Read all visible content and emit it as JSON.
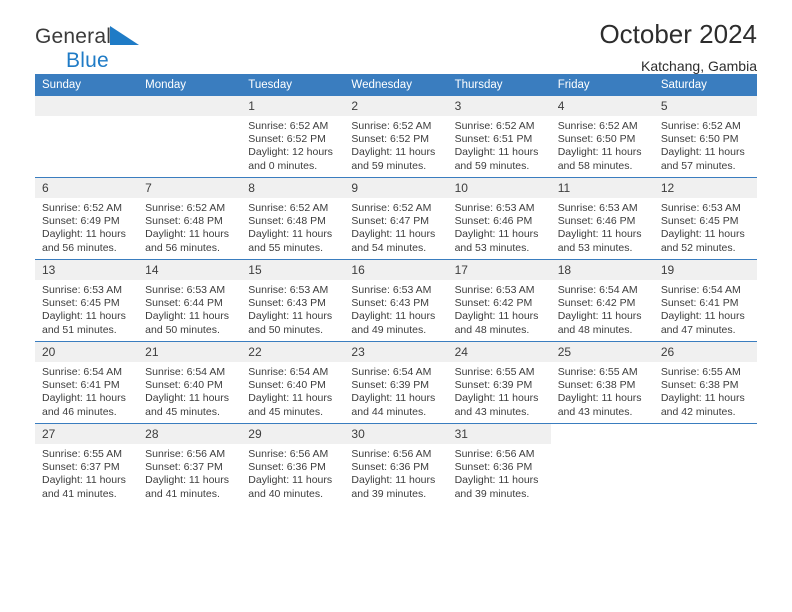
{
  "brand": {
    "name_top": "General",
    "name_bottom": "Blue",
    "flag_icon": "blue-triangle-flag-icon",
    "accent_color": "#1f7bc6"
  },
  "header": {
    "title": "October 2024",
    "subtitle": "Katchang, Gambia"
  },
  "calendar": {
    "header_bg": "#3a7dbf",
    "daynum_bg": "#f0f0f0",
    "weekday_headers": [
      "Sunday",
      "Monday",
      "Tuesday",
      "Wednesday",
      "Thursday",
      "Friday",
      "Saturday"
    ],
    "weeks": [
      [
        {
          "day": "",
          "info": ""
        },
        {
          "day": "",
          "info": ""
        },
        {
          "day": "1",
          "info": "Sunrise: 6:52 AM\nSunset: 6:52 PM\nDaylight: 12 hours\nand 0 minutes."
        },
        {
          "day": "2",
          "info": "Sunrise: 6:52 AM\nSunset: 6:52 PM\nDaylight: 11 hours\nand 59 minutes."
        },
        {
          "day": "3",
          "info": "Sunrise: 6:52 AM\nSunset: 6:51 PM\nDaylight: 11 hours\nand 59 minutes."
        },
        {
          "day": "4",
          "info": "Sunrise: 6:52 AM\nSunset: 6:50 PM\nDaylight: 11 hours\nand 58 minutes."
        },
        {
          "day": "5",
          "info": "Sunrise: 6:52 AM\nSunset: 6:50 PM\nDaylight: 11 hours\nand 57 minutes."
        }
      ],
      [
        {
          "day": "6",
          "info": "Sunrise: 6:52 AM\nSunset: 6:49 PM\nDaylight: 11 hours\nand 56 minutes."
        },
        {
          "day": "7",
          "info": "Sunrise: 6:52 AM\nSunset: 6:48 PM\nDaylight: 11 hours\nand 56 minutes."
        },
        {
          "day": "8",
          "info": "Sunrise: 6:52 AM\nSunset: 6:48 PM\nDaylight: 11 hours\nand 55 minutes."
        },
        {
          "day": "9",
          "info": "Sunrise: 6:52 AM\nSunset: 6:47 PM\nDaylight: 11 hours\nand 54 minutes."
        },
        {
          "day": "10",
          "info": "Sunrise: 6:53 AM\nSunset: 6:46 PM\nDaylight: 11 hours\nand 53 minutes."
        },
        {
          "day": "11",
          "info": "Sunrise: 6:53 AM\nSunset: 6:46 PM\nDaylight: 11 hours\nand 53 minutes."
        },
        {
          "day": "12",
          "info": "Sunrise: 6:53 AM\nSunset: 6:45 PM\nDaylight: 11 hours\nand 52 minutes."
        }
      ],
      [
        {
          "day": "13",
          "info": "Sunrise: 6:53 AM\nSunset: 6:45 PM\nDaylight: 11 hours\nand 51 minutes."
        },
        {
          "day": "14",
          "info": "Sunrise: 6:53 AM\nSunset: 6:44 PM\nDaylight: 11 hours\nand 50 minutes."
        },
        {
          "day": "15",
          "info": "Sunrise: 6:53 AM\nSunset: 6:43 PM\nDaylight: 11 hours\nand 50 minutes."
        },
        {
          "day": "16",
          "info": "Sunrise: 6:53 AM\nSunset: 6:43 PM\nDaylight: 11 hours\nand 49 minutes."
        },
        {
          "day": "17",
          "info": "Sunrise: 6:53 AM\nSunset: 6:42 PM\nDaylight: 11 hours\nand 48 minutes."
        },
        {
          "day": "18",
          "info": "Sunrise: 6:54 AM\nSunset: 6:42 PM\nDaylight: 11 hours\nand 48 minutes."
        },
        {
          "day": "19",
          "info": "Sunrise: 6:54 AM\nSunset: 6:41 PM\nDaylight: 11 hours\nand 47 minutes."
        }
      ],
      [
        {
          "day": "20",
          "info": "Sunrise: 6:54 AM\nSunset: 6:41 PM\nDaylight: 11 hours\nand 46 minutes."
        },
        {
          "day": "21",
          "info": "Sunrise: 6:54 AM\nSunset: 6:40 PM\nDaylight: 11 hours\nand 45 minutes."
        },
        {
          "day": "22",
          "info": "Sunrise: 6:54 AM\nSunset: 6:40 PM\nDaylight: 11 hours\nand 45 minutes."
        },
        {
          "day": "23",
          "info": "Sunrise: 6:54 AM\nSunset: 6:39 PM\nDaylight: 11 hours\nand 44 minutes."
        },
        {
          "day": "24",
          "info": "Sunrise: 6:55 AM\nSunset: 6:39 PM\nDaylight: 11 hours\nand 43 minutes."
        },
        {
          "day": "25",
          "info": "Sunrise: 6:55 AM\nSunset: 6:38 PM\nDaylight: 11 hours\nand 43 minutes."
        },
        {
          "day": "26",
          "info": "Sunrise: 6:55 AM\nSunset: 6:38 PM\nDaylight: 11 hours\nand 42 minutes."
        }
      ],
      [
        {
          "day": "27",
          "info": "Sunrise: 6:55 AM\nSunset: 6:37 PM\nDaylight: 11 hours\nand 41 minutes."
        },
        {
          "day": "28",
          "info": "Sunrise: 6:56 AM\nSunset: 6:37 PM\nDaylight: 11 hours\nand 41 minutes."
        },
        {
          "day": "29",
          "info": "Sunrise: 6:56 AM\nSunset: 6:36 PM\nDaylight: 11 hours\nand 40 minutes."
        },
        {
          "day": "30",
          "info": "Sunrise: 6:56 AM\nSunset: 6:36 PM\nDaylight: 11 hours\nand 39 minutes."
        },
        {
          "day": "31",
          "info": "Sunrise: 6:56 AM\nSunset: 6:36 PM\nDaylight: 11 hours\nand 39 minutes."
        },
        {
          "day": "",
          "info": ""
        },
        {
          "day": "",
          "info": ""
        }
      ]
    ]
  }
}
